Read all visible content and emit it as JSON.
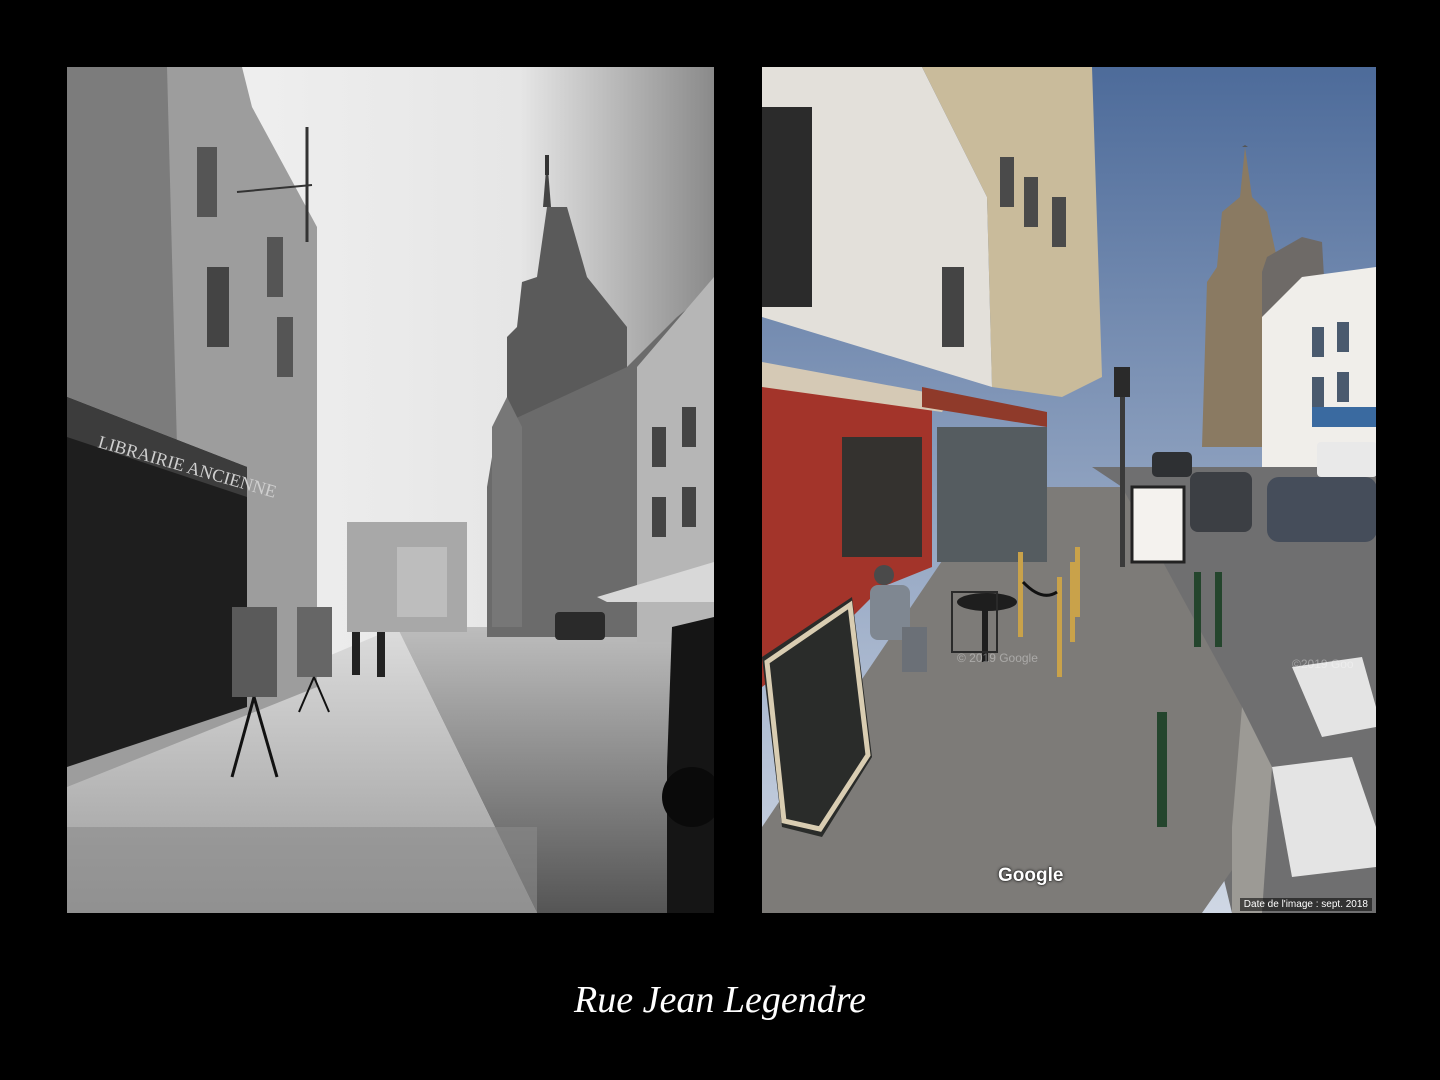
{
  "left_photo": {
    "sign_text": "LIBRAIRIE ANCIENNE"
  },
  "right_photo": {
    "watermark": "Google",
    "faint_watermark_1": "© 2019 Google",
    "faint_watermark_2": "©2019 Goo",
    "date_stamp": "Date de l'image : sept. 2018"
  },
  "caption": "Rue Jean Legendre"
}
